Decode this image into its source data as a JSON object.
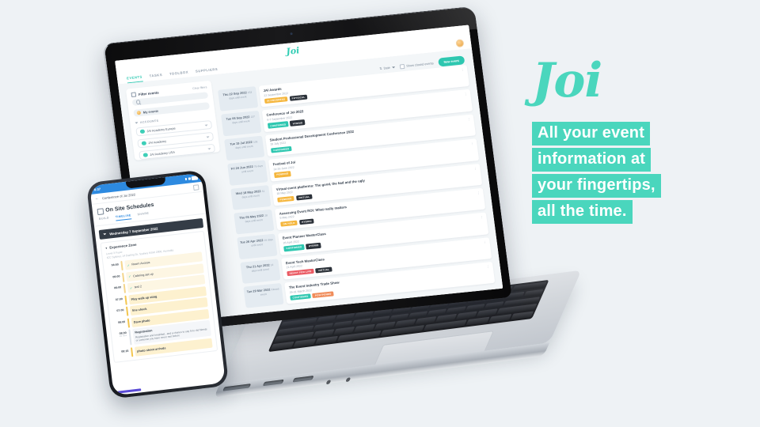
{
  "background_color": "#eef2f5",
  "brand": {
    "name": "Joi",
    "accent": "#4ad6bd",
    "teal": "#2ec7b0",
    "blue": "#2d8ae0"
  },
  "promo": {
    "logo": "Joi",
    "lines": [
      "All your event",
      "information at",
      "your fingertips,",
      "all the time."
    ]
  },
  "laptop": {
    "app": {
      "logo": "Joi",
      "nav": [
        {
          "label": "EVENTS",
          "active": true
        },
        {
          "label": "TASKS",
          "active": false
        },
        {
          "label": "TOOLBOX",
          "active": false
        },
        {
          "label": "SUPPLIERS",
          "active": false
        }
      ],
      "sidebar": {
        "filter_title": "Filter events",
        "clear_label": "Clear filters",
        "search_placeholder": "Search",
        "my_events_label": "My events",
        "accounts_label": "ACCOUNTS",
        "accounts": [
          {
            "name": "JAI Academy Europe"
          },
          {
            "name": "JAI Academy"
          },
          {
            "name": "JAI Academy USA"
          }
        ]
      },
      "toolbar": {
        "sort_label": "Date",
        "show_closed_label": "Show closed events",
        "new_event_label": "New event",
        "view_label": "View"
      },
      "events": [
        {
          "date": "Thu 22 Sep 2022",
          "countdown": "153 days until event",
          "title": "JAI Awards",
          "subtitle": "22 September 2022",
          "tags": [
            {
              "label": "IN PROGRESS",
              "color": "#f5b63c"
            },
            {
              "label": "PHYSICAL",
              "color": "#2b3139"
            }
          ]
        },
        {
          "date": "Tue 06 Sep 2022",
          "countdown": "137 days until event",
          "title": "Conference of Joi 2022",
          "subtitle": "6-7 September 2022",
          "tags": [
            {
              "label": "CONFIRMED",
              "color": "#2ec7b0"
            },
            {
              "label": "HYBRID",
              "color": "#2b3139"
            }
          ]
        },
        {
          "date": "Tue 19 Jul 2022",
          "countdown": "103 days until event",
          "title": "Student Professional Development Conference 2022",
          "subtitle": "19 July 2022",
          "tags": [
            {
              "label": "CONFIRMED",
              "color": "#2ec7b0"
            }
          ]
        },
        {
          "date": "Fri 24 Jun 2022",
          "countdown": "78 days until event",
          "title": "Festival of Joi",
          "subtitle": "24-26 June 2022",
          "tags": [
            {
              "label": "PENDING",
              "color": "#f5b63c"
            }
          ]
        },
        {
          "date": "Wed 18 May 2022",
          "countdown": "41 days until event",
          "title": "Virtual event platforms: The good, the bad and the ugly",
          "subtitle": "18 May 2022",
          "tags": [
            {
              "label": "PENDING",
              "color": "#f5b63c"
            },
            {
              "label": "VIRTUAL",
              "color": "#2b3139"
            }
          ]
        },
        {
          "date": "Thu 05 May 2022",
          "countdown": "28 days until event",
          "title": "Assessing Event ROI: What really matters",
          "subtitle": "5 May 2022",
          "tags": [
            {
              "label": "ON HOLD",
              "color": "#f5b63c"
            },
            {
              "label": "HYBRID",
              "color": "#2b3139"
            }
          ]
        },
        {
          "date": "Tue 26 Apr 2022",
          "countdown": "19 days until event",
          "title": "Event Planner MasterClass",
          "subtitle": "26 April 2022",
          "tags": [
            {
              "label": "CONFIRMED",
              "color": "#2ec7b0"
            },
            {
              "label": "HYBRID",
              "color": "#2b3139"
            }
          ]
        },
        {
          "date": "Thu 21 Apr 2022",
          "countdown": "14 days until event",
          "title": "Event Tech MasterClass",
          "subtitle": "21 April 2022",
          "tags": [
            {
              "label": "READY FOR LIVE",
              "color": "#ea5a63"
            },
            {
              "label": "VIRTUAL",
              "color": "#2b3139"
            }
          ]
        },
        {
          "date": "Tue 29 Mar 2022",
          "countdown": "Closed event",
          "title": "The Event Industry Trade Show",
          "subtitle": "29-31 March 2022",
          "tags": [
            {
              "label": "CONFIRMED",
              "color": "#2ec7b0"
            },
            {
              "label": "POSTPONED",
              "color": "#f08c5a"
            }
          ]
        }
      ]
    }
  },
  "phone": {
    "status_time": "8:37",
    "breadcrumb": "Conference of Joi 2022",
    "title": "On Site Schedules",
    "tabs": [
      {
        "label": "BUILD",
        "active": false
      },
      {
        "label": "TIMELINE",
        "active": true
      },
      {
        "label": "SHARE",
        "active": false
      }
    ],
    "day_header": "Wednesday 7 September 2022",
    "zone_title": "Experience Zone",
    "location_line1": "Level 3 Foyer",
    "location_line2": "ICC Sydney, 14 Darling Dr, Sydney NSW 2000, Australia",
    "schedule": [
      {
        "time": "04:00",
        "duration": "",
        "label": "Room Access",
        "check": true,
        "style": "cream",
        "bar": "#f4d58b",
        "desc": ""
      },
      {
        "time": "06:00",
        "duration": "",
        "label": "Catering set up",
        "check": true,
        "style": "cream",
        "bar": "#f4d58b",
        "desc": ""
      },
      {
        "time": "06:00",
        "duration": "",
        "label": "test 2",
        "check": true,
        "style": "cream",
        "bar": "#f4d58b",
        "desc": ""
      },
      {
        "time": "07:00",
        "duration": "",
        "label": "Play walk up sting",
        "check": false,
        "style": "cream",
        "bar": "#f3c64f",
        "desc": ""
      },
      {
        "time": "07:00",
        "duration": "",
        "label": "line check",
        "check": false,
        "style": "cream",
        "bar": "#f3c64f",
        "desc": ""
      },
      {
        "time": "08:00",
        "duration": "",
        "label": "Dave photo",
        "check": false,
        "style": "cream",
        "bar": "#f3c64f",
        "desc": ""
      },
      {
        "time": "08:00",
        "duration": "1hr 00m",
        "label": "Registration",
        "check": false,
        "style": "grey",
        "bar": "#dfe4ea",
        "desc": "Registration and breakfast...and a chance to say hi to old friends or someone you have never met before"
      },
      {
        "time": "08:15",
        "duration": "",
        "label": "photo shoot arrivals",
        "check": false,
        "style": "cream",
        "bar": "#f3c64f",
        "desc": ""
      }
    ]
  }
}
